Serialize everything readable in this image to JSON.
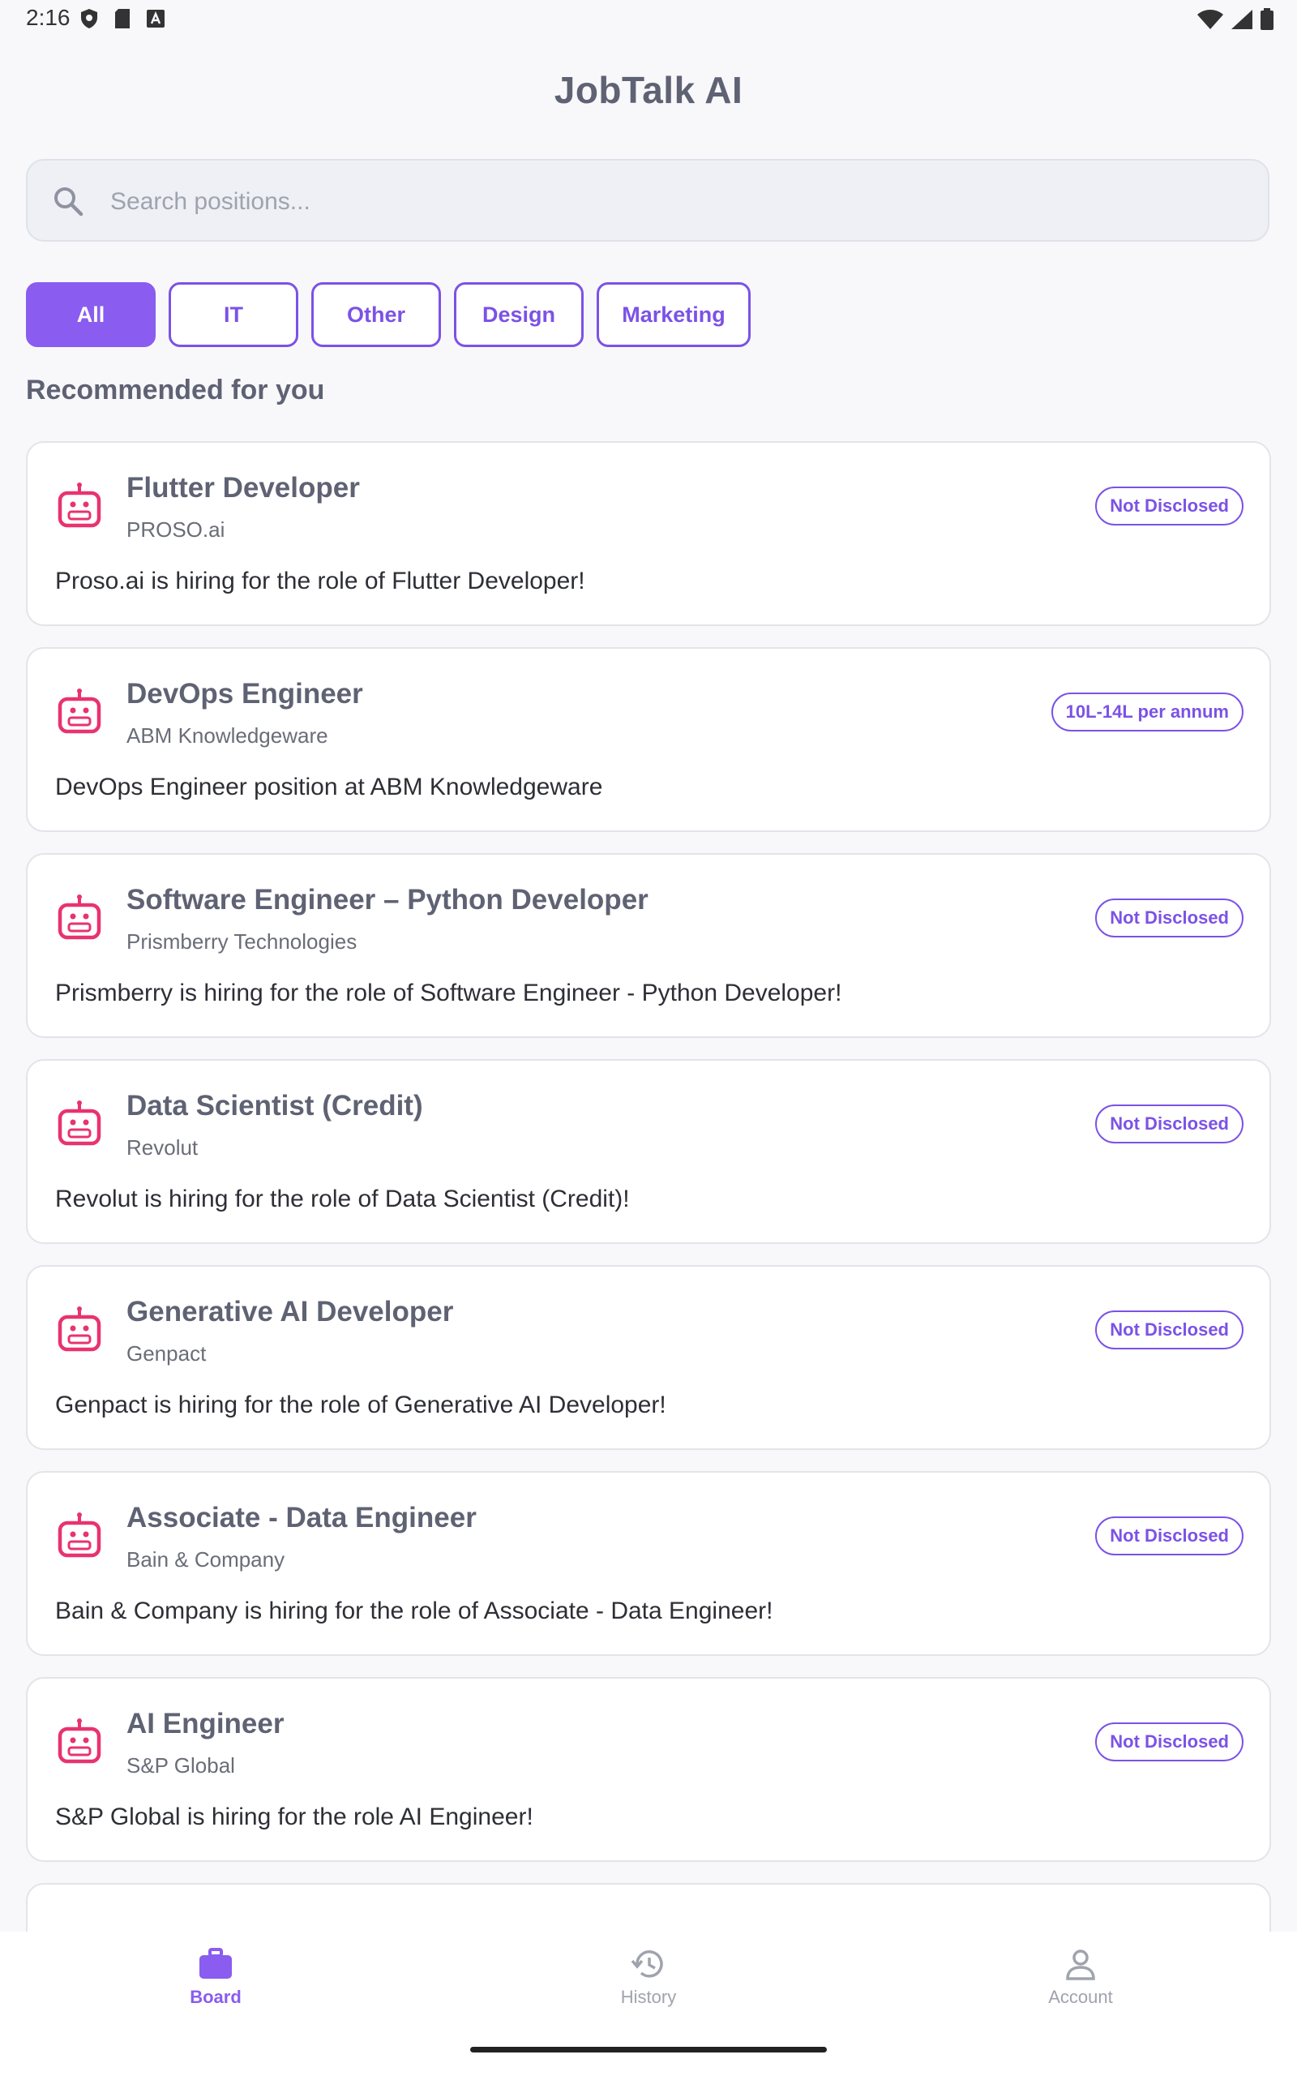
{
  "status_bar": {
    "time": "2:16"
  },
  "app": {
    "title": "JobTalk AI"
  },
  "search": {
    "placeholder": "Search positions..."
  },
  "filters": [
    {
      "label": "All",
      "active": true,
      "width": 160
    },
    {
      "label": "IT",
      "active": false,
      "width": 160
    },
    {
      "label": "Other",
      "active": false,
      "width": 160
    },
    {
      "label": "Design",
      "active": false,
      "width": 160
    },
    {
      "label": "Marketing",
      "active": false,
      "width": 190
    }
  ],
  "section": {
    "title": "Recommended for you"
  },
  "jobs": [
    {
      "title": "Flutter Developer",
      "company": "PROSO.ai",
      "salary": "Not Disclosed",
      "description": "Proso.ai is hiring for the role of Flutter Developer!"
    },
    {
      "title": "DevOps Engineer",
      "company": "ABM Knowledgeware",
      "salary": "10L-14L per annum",
      "description": "DevOps Engineer position at ABM Knowledgeware"
    },
    {
      "title": "Software Engineer – Python Developer",
      "company": "Prismberry Technologies",
      "salary": "Not Disclosed",
      "description": "Prismberry is hiring for the role of Software Engineer - Python Developer!"
    },
    {
      "title": "Data Scientist (Credit)",
      "company": "Revolut",
      "salary": "Not Disclosed",
      "description": "Revolut is hiring for the role of Data Scientist (Credit)!"
    },
    {
      "title": "Generative AI Developer",
      "company": "Genpact",
      "salary": "Not Disclosed",
      "description": "Genpact is hiring for the role of Generative AI Developer!"
    },
    {
      "title": "Associate - Data Engineer",
      "company": "Bain & Company",
      "salary": "Not Disclosed",
      "description": "Bain & Company is hiring for the role of Associate - Data Engineer!"
    },
    {
      "title": "AI Engineer",
      "company": "S&P Global",
      "salary": "Not Disclosed",
      "description": "S&P Global is hiring for the role AI Engineer!"
    }
  ],
  "bottom_nav": [
    {
      "label": "Board",
      "icon": "briefcase-icon",
      "active": true
    },
    {
      "label": "History",
      "icon": "history-icon",
      "active": false
    },
    {
      "label": "Account",
      "icon": "person-icon",
      "active": false
    }
  ],
  "colors": {
    "accent": "#8a5cf0",
    "job_icon": "#e8336f",
    "title": "#5e6273"
  }
}
